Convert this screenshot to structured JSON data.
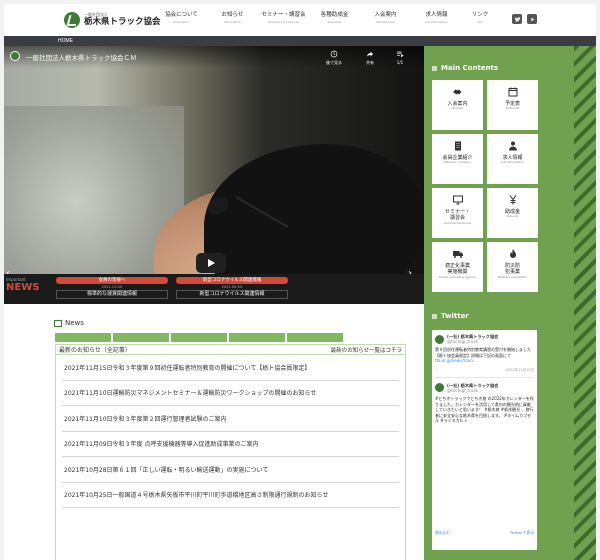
{
  "header": {
    "logo_sub": "一般社団法人",
    "logo_title": "栃木県トラック協会",
    "nav": [
      {
        "label": "協会について",
        "sub": "Association"
      },
      {
        "label": "お知らせ",
        "sub": "Information"
      },
      {
        "label": "セミナー・講習会",
        "sub": "Seminars & Lectures"
      },
      {
        "label": "各種助成金",
        "sub": "Subsidies"
      },
      {
        "label": "入会案内",
        "sub": "Membership"
      },
      {
        "label": "求人情報",
        "sub": "Job Information"
      },
      {
        "label": "リンク",
        "sub": "Link"
      }
    ]
  },
  "breadcrumb": "HOME",
  "video": {
    "title": "一般社団法人栃木県トラック協会ＣＭ",
    "controls": [
      {
        "icon": "watch-later-icon",
        "label": "後で見る"
      },
      {
        "icon": "share-icon",
        "label": "共有"
      },
      {
        "icon": "playlist-icon",
        "label": "1/1"
      }
    ]
  },
  "important": {
    "small": "Important",
    "big": "NEWS",
    "items": [
      {
        "pill": "会員の皆様へ",
        "date": "2021.11.XX",
        "text": "標準的な運賃関連情報"
      },
      {
        "pill": "新型コロナウイルス関連情報",
        "date": "2021.XX.XX",
        "text": "新型コロナウイルス関連情報"
      }
    ]
  },
  "news": {
    "heading": "News",
    "tabs": [
      "",
      "",
      "",
      "",
      ""
    ],
    "list_label": "最新のお知らせ（全記事）",
    "more": "最新のお知らせ一覧はコチラ",
    "items": [
      "2021年11月15日令和３年度第９回初任運転者特別教育の開催について【栃ト協会員限定】",
      "2021年11月10日運輸防災マネジメントセミナー＆運輸防災ワークショップの開催のお知らせ",
      "2021年11月10日令和３年度第２回運行管理者試験のご案内",
      "2021年11月09日令和３年度 点呼支援機器等導入促進助成事業のご案内",
      "2021年10月28日第６１回「正しい運転・明るい輸送運動」の実施について",
      "2021年10月25日一般国道４号栃木県矢板市平川町平川町歩道橋地区高さ制限通行規制のお知らせ"
    ]
  },
  "sidebar": {
    "main_heading": "Main Contents",
    "tiles": [
      {
        "icon": "handshake-icon",
        "label": "入会案内",
        "sub": "Member"
      },
      {
        "icon": "calendar-icon",
        "label": "予定表",
        "sub": "Schedule"
      },
      {
        "icon": "building-icon",
        "label": "会員企業紹介",
        "sub": "Member company"
      },
      {
        "icon": "person-icon",
        "label": "求人情報",
        "sub": "Job information"
      },
      {
        "icon": "monitor-icon",
        "label": "セミナー・\n講習会",
        "sub": "Seminars/lectures"
      },
      {
        "icon": "yen-icon",
        "label": "助成金",
        "sub": "Subsidy"
      },
      {
        "icon": "truck-icon",
        "label": "適正化事業\n実施機関",
        "sub": "Proper operating agency"
      },
      {
        "icon": "fire-icon",
        "label": "防災防\n犯事業",
        "sub": "Disaster prevention"
      }
    ],
    "twitter_heading": "Twitter",
    "tweets": [
      {
        "name": "(一社) 栃木県トラック協会",
        "handle": "@tochigi_truck",
        "text": "第９回初任運転者特別教育講習の受付を開始しました【栃ト協会員限定】詳細は下記の画面にて",
        "link": "tta.or.jp/news/train...",
        "date": "2021年11月15日"
      },
      {
        "name": "(一社) 栃木県トラック協会",
        "handle": "@tochigi_truck",
        "text": "#とちぎトラックでとちぎ旅 の2022年カレンダーを作りました。カレンダーを活用して県内の観光地に貢献していきたいと思います！ #栃木旅 #栃木観光 、旅行者に安全安心な栃木県を目指します。 #タイムカプセル #ラミスカルト",
        "link": "",
        "date": ""
      }
    ],
    "embed": "埋め込む",
    "view_on": "Twitterで表示"
  },
  "colors": {
    "green": "#6fa14e",
    "dark_green": "#3e7b34",
    "red": "#d24b3a",
    "tab_green": "#80b864"
  }
}
